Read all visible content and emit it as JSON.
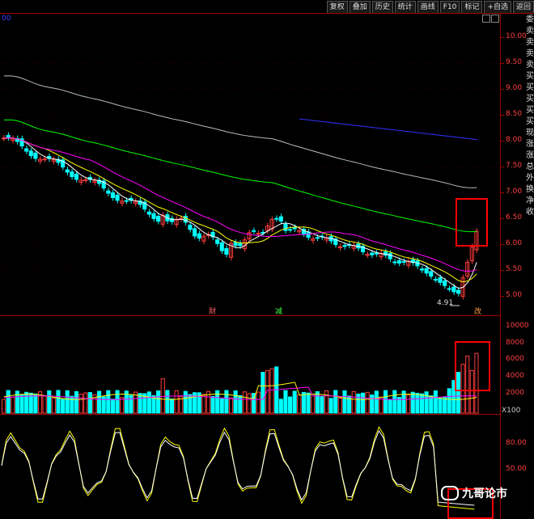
{
  "toolbar": [
    "复权",
    "叠加",
    "历史",
    "统计",
    "画线",
    "F10",
    "标记",
    "+自选",
    "返回"
  ],
  "top_left_label": "00",
  "price_axis": [
    "10.00",
    "9.50",
    "9.00",
    "8.50",
    "8.00",
    "7.50",
    "7.00",
    "6.50",
    "6.00",
    "5.50",
    "5.00"
  ],
  "volume_axis": [
    "10000",
    "8000",
    "6000",
    "4000",
    "2000"
  ],
  "volume_unit": "X100",
  "indicator_axis": [
    "80.00",
    "50.00"
  ],
  "side_text": [
    "委",
    "卖",
    "卖",
    "卖",
    "卖",
    "买",
    "买",
    "买",
    "买",
    "买",
    "现",
    "涨",
    "涨",
    "总",
    "外",
    "换",
    "净",
    "收"
  ],
  "low_price_marker": "4.91",
  "markers": {
    "cai": "财",
    "jian": "减",
    "gai": "改"
  },
  "watermark": "九哥论市",
  "colors": {
    "up": "#ff3c3c",
    "down": "#00ffff",
    "ma5": "#ffffff",
    "ma10": "#ffff00",
    "ma20": "#ff00ff",
    "ma60": "#00ff00",
    "ma120": "#bbbbbb",
    "ma250": "#3333ff",
    "highlight_box": "#ff0000",
    "axis": "#a00000"
  }
}
